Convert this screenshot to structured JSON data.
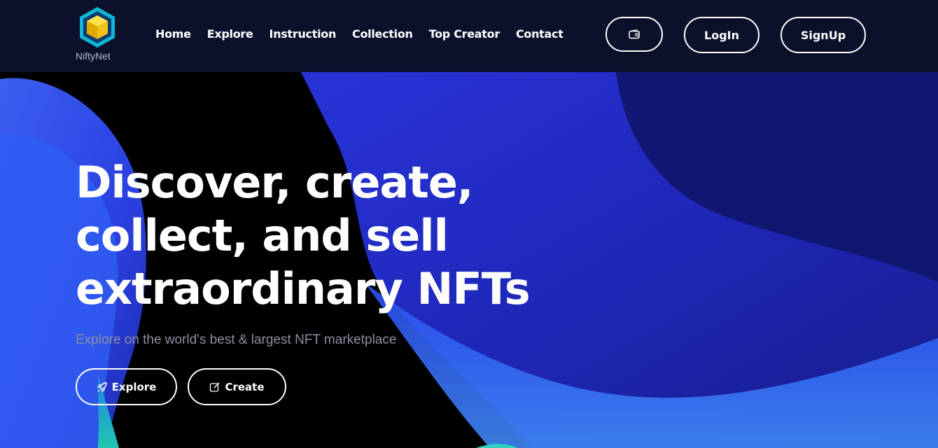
{
  "brand": {
    "name": "NiftyNet",
    "logo_icon": "cube-logo-icon",
    "colors": {
      "nav_bg": "#0b112b",
      "accent_cyan": "#1fc9e8",
      "accent_yellow": "#f2c21b",
      "hero_blue": "#2e3ce0"
    }
  },
  "nav": {
    "links": [
      "Home",
      "Explore",
      "Instruction",
      "Collection",
      "Top Creator",
      "Contact"
    ],
    "wallet_icon": "wallet-icon",
    "login_label": "LogIn",
    "signup_label": "SignUp"
  },
  "hero": {
    "title_line1": "Discover, create,",
    "title_line2": "collect, and sell",
    "title_line3": "extraordinary NFTs",
    "subtitle": "Explore on the world's best & largest NFT marketplace",
    "explore_label": "Explore",
    "explore_icon": "rocket-icon",
    "create_label": "Create",
    "create_icon": "edit-icon"
  }
}
